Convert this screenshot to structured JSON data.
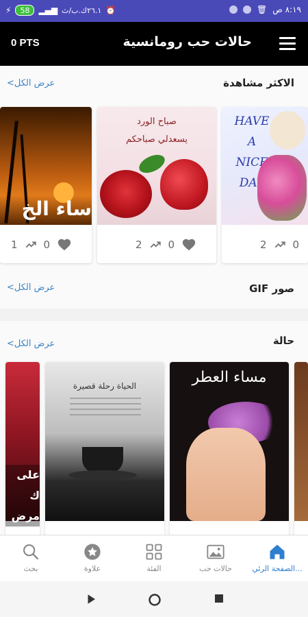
{
  "status_bar": {
    "time": "٨:١٩ ص",
    "battery": "58",
    "net_speed": "٢٦.١ك.ب/ث"
  },
  "app_bar": {
    "points": "0 PTS",
    "title": "حالات حب رومانسية",
    "menu_icon": "hamburger-menu-icon"
  },
  "sections": {
    "most_viewed": {
      "title": "الاكثر مشاهدة",
      "see_all": "عرض الكل>",
      "cards": [
        {
          "likes": "0",
          "views": "1",
          "image_text": "ساء الخ"
        },
        {
          "likes": "0",
          "views": "2",
          "image_text_line1": "صباح الورد",
          "image_text_line2": "يسعدلي صباحكم"
        },
        {
          "likes": "0",
          "views": "2",
          "image_text": "HAVE A NICE DAY"
        }
      ]
    },
    "gif": {
      "title": "صور GIF",
      "see_all": "عرض الكل>"
    },
    "status": {
      "title": "حالة",
      "see_all": "عرض الكل>",
      "cards": [
        {
          "image_text": "على ك مرض"
        },
        {
          "image_text": "الحياة رحلة قصيرة"
        },
        {
          "image_text": "مساء العطر"
        }
      ]
    }
  },
  "bottom_nav": [
    {
      "label": "بحث",
      "icon": "search-icon"
    },
    {
      "label": "علاوة",
      "icon": "star-badge-icon"
    },
    {
      "label": "الفئة",
      "icon": "grid-icon"
    },
    {
      "label": "حالات حب",
      "icon": "image-icon"
    },
    {
      "label": "الصفحة الرئي...",
      "icon": "home-icon",
      "active": true
    }
  ],
  "colors": {
    "status_bar": "#4a49b8",
    "app_bar": "#000000",
    "accent": "#2f7fd0"
  }
}
